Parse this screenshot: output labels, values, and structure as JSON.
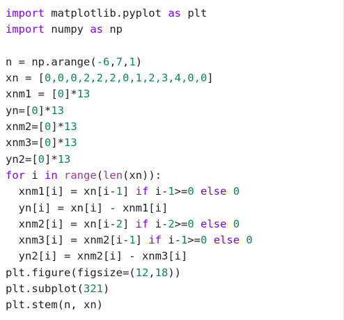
{
  "colors": {
    "background": "#ffffff",
    "text": "#1f1f1f",
    "keyword": "#8000ff",
    "number": "#098658",
    "builtin": "#a03a8a"
  },
  "code": {
    "line1": {
      "a": "import",
      "b": " matplotlib.pyplot ",
      "c": "as",
      "d": " plt"
    },
    "line2": {
      "a": "import",
      "b": " numpy ",
      "c": "as",
      "d": " np"
    },
    "line4": {
      "a": "n = np.arange(",
      "b": "-6",
      "c": ",",
      "d": "7",
      "e": ",",
      "f": "1",
      "g": ")"
    },
    "line5": {
      "a": "xn = [",
      "b": "0,0,0,2,2,2,0,1,2,3,4,0,0",
      "c": "]"
    },
    "line6": {
      "a": "xnm1 = [",
      "b": "0",
      "c": "]*",
      "d": "13"
    },
    "line7": {
      "a": "yn=[",
      "b": "0",
      "c": "]*",
      "d": "13"
    },
    "line8": {
      "a": "xnm2=[",
      "b": "0",
      "c": "]*",
      "d": "13"
    },
    "line9": {
      "a": "xnm3=[",
      "b": "0",
      "c": "]*",
      "d": "13"
    },
    "line10": {
      "a": "yn2=[",
      "b": "0",
      "c": "]*",
      "d": "13"
    },
    "line11": {
      "a": "for",
      "b": " i ",
      "c": "in",
      "d": " ",
      "e": "range",
      "f": "(",
      "g": "len",
      "h": "(xn)):"
    },
    "line12": {
      "a": "  xnm1[i] = xn[i-",
      "b": "1",
      "c": "] ",
      "d": "if",
      "e": " i-",
      "f": "1",
      "g": ">=",
      "h": "0",
      "i": " ",
      "j": "else",
      "k": " ",
      "l": "0"
    },
    "line13": {
      "a": "  yn[i] = xn[i] - xnm1[i]"
    },
    "line14": {
      "a": "  xnm2[i] = xn[i-",
      "b": "2",
      "c": "] ",
      "d": "if",
      "e": " i-",
      "f": "2",
      "g": ">=",
      "h": "0",
      "i": " ",
      "j": "else",
      "k": " ",
      "l": "0"
    },
    "line15": {
      "a": "  xnm3[i] = xnm2[i-",
      "b": "1",
      "c": "] ",
      "d": "if",
      "e": " i-",
      "f": "1",
      "g": ">=",
      "h": "0",
      "i": " ",
      "j": "else",
      "k": " ",
      "l": "0"
    },
    "line16": {
      "a": "  yn2[i] = xnm2[i] - xnm3[i]"
    },
    "line17": {
      "a": "plt.figure(figsize=(",
      "b": "12",
      "c": ",",
      "d": "18",
      "e": "))"
    },
    "line18": {
      "a": "plt.subplot(",
      "b": "321",
      "c": ")"
    },
    "line19": {
      "a": "plt.stem(n, xn)"
    }
  }
}
